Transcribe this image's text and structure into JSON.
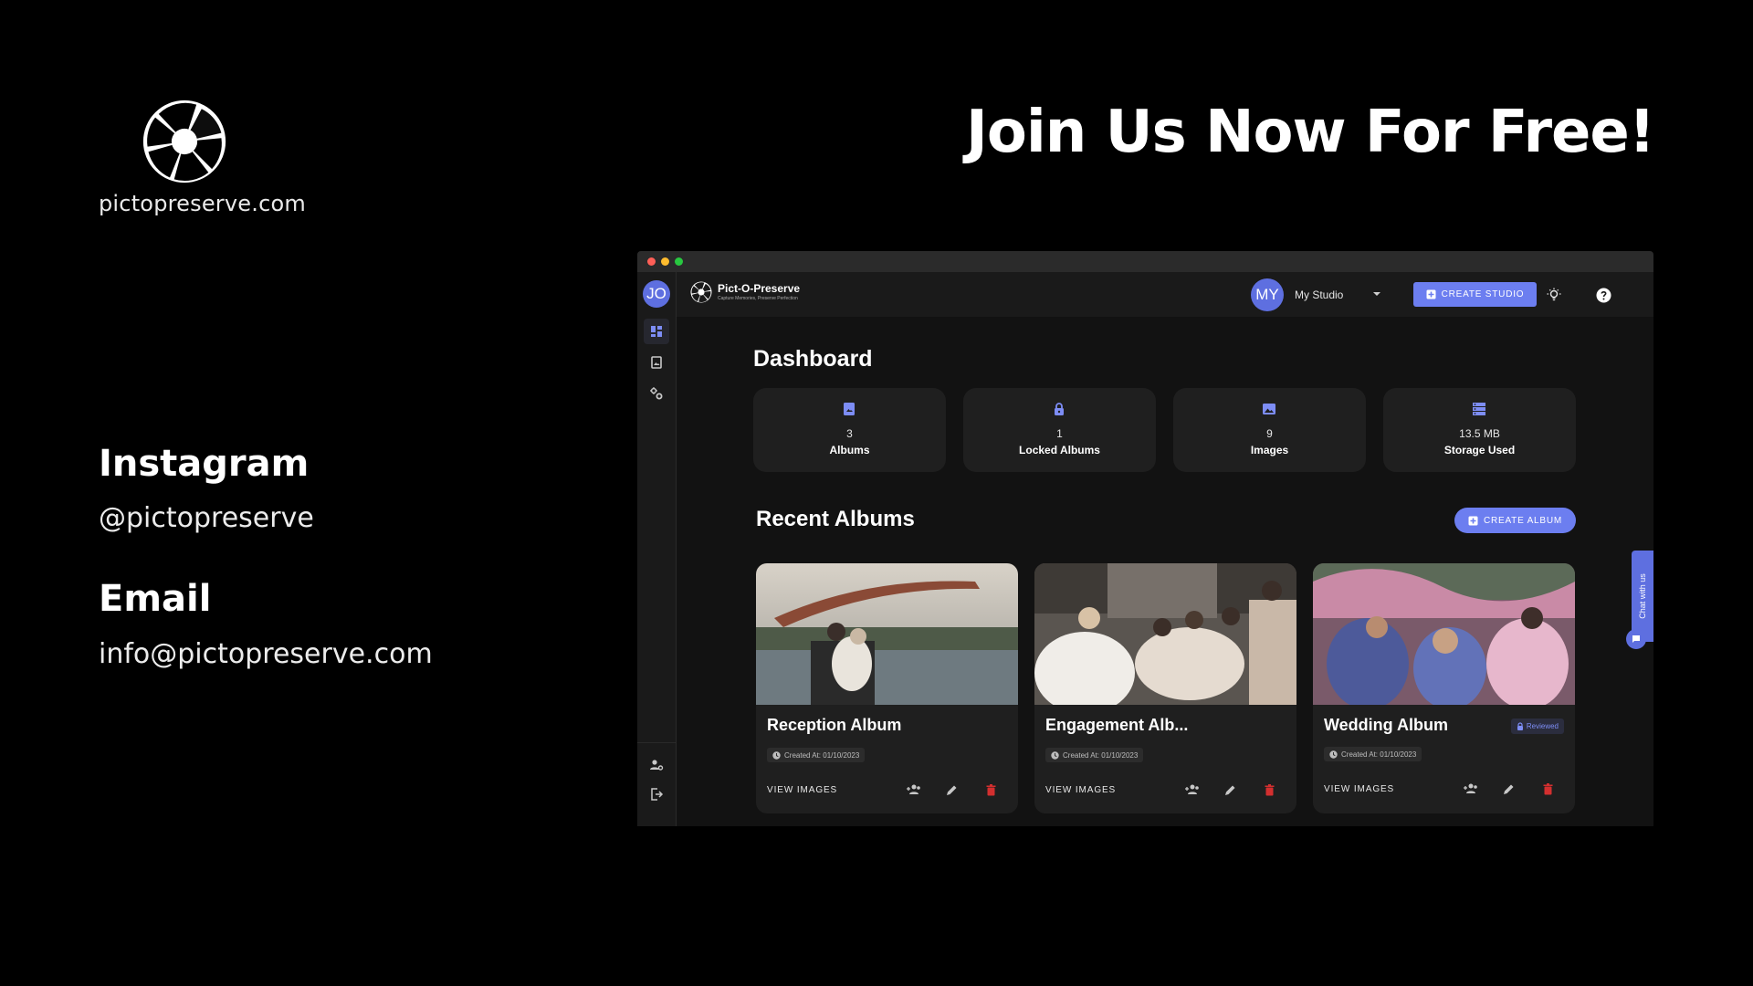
{
  "promo": {
    "site": "pictopreserve.com",
    "headline": "Join Us Now For Free!",
    "instagram_heading": "Instagram",
    "instagram_handle": "@pictopreserve",
    "email_heading": "Email",
    "email_address": "info@pictopreserve.com"
  },
  "app": {
    "name": "Pict-O-Preserve",
    "tagline": "Capture Memories, Preserve Perfection",
    "user_initials": "JO",
    "studio_initials": "MY",
    "studio_name": "My Studio",
    "create_studio_label": "CREATE STUDIO",
    "dashboard_title": "Dashboard",
    "stats": [
      {
        "value": "3",
        "label": "Albums",
        "icon": "album-icon"
      },
      {
        "value": "1",
        "label": "Locked Albums",
        "icon": "lock-icon"
      },
      {
        "value": "9",
        "label": "Images",
        "icon": "image-icon"
      },
      {
        "value": "13.5 MB",
        "label": "Storage Used",
        "icon": "storage-icon"
      }
    ],
    "recent_title": "Recent Albums",
    "create_album_label": "CREATE ALBUM",
    "albums": [
      {
        "title": "Reception Album",
        "created": "Created At: 01/10/2023",
        "action": "VIEW IMAGES",
        "badge": ""
      },
      {
        "title": "Engagement Alb...",
        "created": "Created At: 01/10/2023",
        "action": "VIEW IMAGES",
        "badge": ""
      },
      {
        "title": "Wedding Album",
        "created": "Created At: 01/10/2023",
        "action": "VIEW IMAGES",
        "badge": "Reviewed"
      }
    ],
    "chat_label": "Chat with us"
  },
  "colors": {
    "accent": "#6c7ef0",
    "delete": "#d32f2f",
    "card_bg": "#1f1f1f",
    "window_bg": "#121212"
  }
}
